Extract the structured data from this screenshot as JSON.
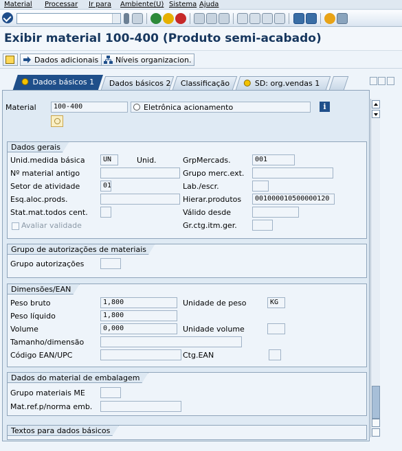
{
  "menu": [
    "Material",
    "Processar",
    "Ir para",
    "Ambiente(U)",
    "Sistema",
    "Ajuda"
  ],
  "page_title": "Exibir material 100-400 (Produto semi-acabado)",
  "app_toolbar": {
    "dados_adicionais": "Dados adicionais",
    "niveis": "Níveis organizacion."
  },
  "tabs": [
    "Dados básicos 1",
    "Dados básicos 2",
    "Classificação",
    "SD: org.vendas 1"
  ],
  "header": {
    "material_label": "Material",
    "material_value": "100-400",
    "material_description": "Eletrônica acionamento"
  },
  "dados_gerais": {
    "title": "Dados gerais",
    "unid_medida_label": "Unid.medida básica",
    "unid_medida_value": "UN",
    "unid_label": "Unid.",
    "grp_mercads_label": "GrpMercads.",
    "grp_mercads_value": "001",
    "num_material_antigo_label": "Nº material antigo",
    "grupo_merc_ext_label": "Grupo merc.ext.",
    "setor_label": "Setor de atividade",
    "setor_value": "01",
    "lab_escr_label": "Lab./escr.",
    "esq_aloc_label": "Esq.aloc.prods.",
    "hierar_label": "Hierar.produtos",
    "hierar_value": "001000010500000120",
    "stat_mat_label": "Stat.mat.todos cent.",
    "valido_label": "Válido desde",
    "avaliar_label": "Avaliar validade",
    "gr_ctg_label": "Gr.ctg.itm.ger."
  },
  "autorizacoes": {
    "title": "Grupo de autorizações de materiais",
    "grupo_label": "Grupo autorizações"
  },
  "dimensoes": {
    "title": "Dimensões/EAN",
    "peso_bruto_label": "Peso bruto",
    "peso_bruto_value": "1,800",
    "unidade_peso_label": "Unidade de peso",
    "unidade_peso_value": "KG",
    "peso_liquido_label": "Peso líquido",
    "peso_liquido_value": "1,800",
    "volume_label": "Volume",
    "volume_value": "0,000",
    "unidade_volume_label": "Unidade volume",
    "tamanho_label": "Tamanho/dimensão",
    "ean_label": "Código EAN/UPC",
    "ctg_ean_label": "Ctg.EAN"
  },
  "embalagem": {
    "title": "Dados do material de embalagem",
    "grupo_me_label": "Grupo materiais ME",
    "mat_ref_label": "Mat.ref.p/norma emb."
  },
  "textos": {
    "title": "Textos para dados básicos"
  },
  "colors": {
    "title_blue": "#17375e",
    "active_tab": "#1f4f8a",
    "background": "#eef4fa"
  }
}
